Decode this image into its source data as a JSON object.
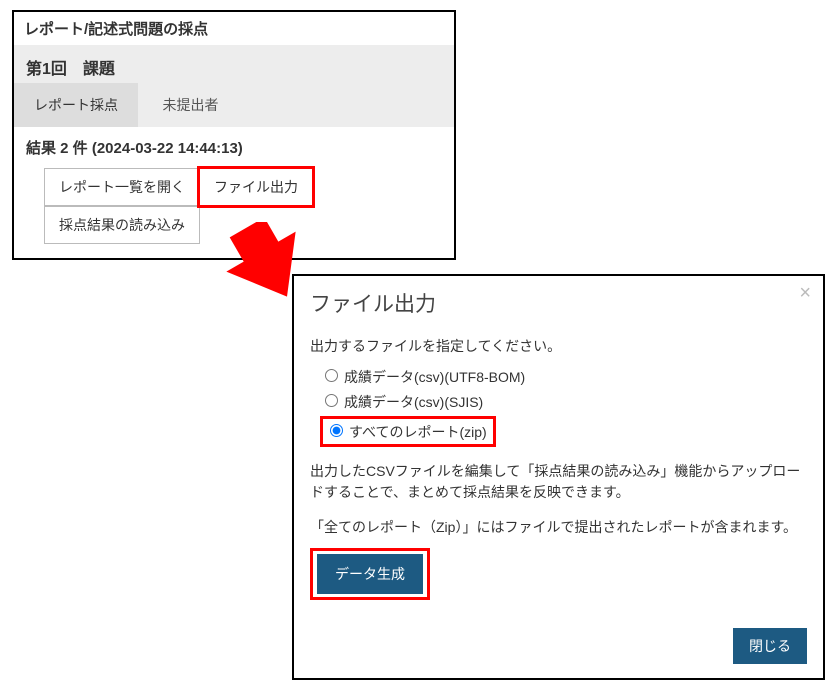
{
  "top": {
    "heading": "レポート/記述式問題の採点",
    "subheading": "第1回　課題",
    "tabs": {
      "active": "レポート採点",
      "other": "未提出者"
    },
    "results": "結果 2 件 (2024-03-22 14:44:13)",
    "buttons": {
      "open_list": "レポート一覧を開く",
      "file_output": "ファイル出力",
      "import_results": "採点結果の読み込み"
    }
  },
  "modal": {
    "title": "ファイル出力",
    "close": "×",
    "desc": "出力するファイルを指定してください。",
    "options": {
      "opt1": "成績データ(csv)(UTF8-BOM)",
      "opt2": "成績データ(csv)(SJIS)",
      "opt3": "すべてのレポート(zip)"
    },
    "note1": "出力したCSVファイルを編集して「採点結果の読み込み」機能からアップロードすることで、まとめて採点結果を反映できます。",
    "note2": "「全てのレポート（Zip）」にはファイルで提出されたレポートが含まれます。",
    "generate": "データ生成",
    "close_btn": "閉じる"
  }
}
